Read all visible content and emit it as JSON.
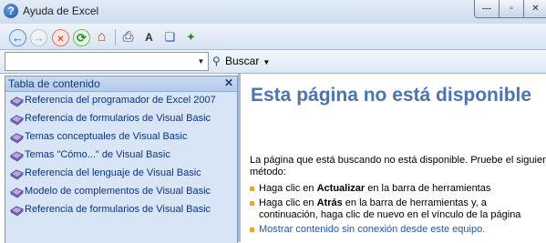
{
  "window": {
    "title": "Ayuda de Excel",
    "app_icon_glyph": "?",
    "controls": {
      "minimize": "—",
      "maximize": "▫",
      "close": "✕"
    }
  },
  "toolbar": {
    "buttons": [
      {
        "name": "back-icon",
        "glyph": "←",
        "color": "#1f58b7"
      },
      {
        "name": "forward-icon",
        "glyph": "→",
        "color": "#9aa8bd"
      },
      {
        "name": "stop-icon",
        "glyph": "✕",
        "color": "#c42b1c"
      },
      {
        "name": "refresh-icon",
        "glyph": "⟳",
        "color": "#2e8b2e"
      },
      {
        "name": "home-icon",
        "glyph": "⌂",
        "color": "#a0522d"
      },
      {
        "name": "print-icon",
        "glyph": "⎙",
        "color": "#404040"
      },
      {
        "name": "font-size-icon",
        "glyph": "A",
        "color": "#303030"
      },
      {
        "name": "toc-book-icon",
        "glyph": "❏",
        "color": "#1f58b7"
      },
      {
        "name": "pin-icon",
        "glyph": "✦",
        "color": "#2e8b2e"
      }
    ]
  },
  "search": {
    "value": "",
    "placeholder": "",
    "button_label": "Buscar"
  },
  "toc": {
    "title": "Tabla de contenido",
    "close_glyph": "✕",
    "items": [
      {
        "label": "Referencia del programador de Excel 2007"
      },
      {
        "label": "Referencia de formularios de Visual Basic"
      },
      {
        "label": "Temas conceptuales de Visual Basic"
      },
      {
        "label": "Temas \"Cómo...\" de Visual Basic"
      },
      {
        "label": "Referencia del lenguaje de Visual Basic"
      },
      {
        "label": "Modelo de complementos de Visual Basic"
      },
      {
        "label": "Referencia de formularios de Visual Basic"
      }
    ]
  },
  "content": {
    "heading": "Esta página no está disponible",
    "message_line1": "La página que está buscando no está disponible. Pruebe el siguiente",
    "message_line2": "método:",
    "bullet1_pre": "Haga clic en ",
    "bullet1_bold": "Actualizar",
    "bullet1_post": " en la barra de herramientas",
    "bullet2_pre": "Haga clic en ",
    "bullet2_bold": "Atrás",
    "bullet2_post": " en la barra de herramientas y, a",
    "bullet2_line2": "continuación, haga clic de nuevo en el vínculo de la página",
    "bullet3_link": "Mostrar contenido sin conexión desde este equipo."
  },
  "colors": {
    "heading": "#4b74b0",
    "toc_text": "#08348b",
    "link": "#1d57b7",
    "bullet": "#e7a72a"
  }
}
